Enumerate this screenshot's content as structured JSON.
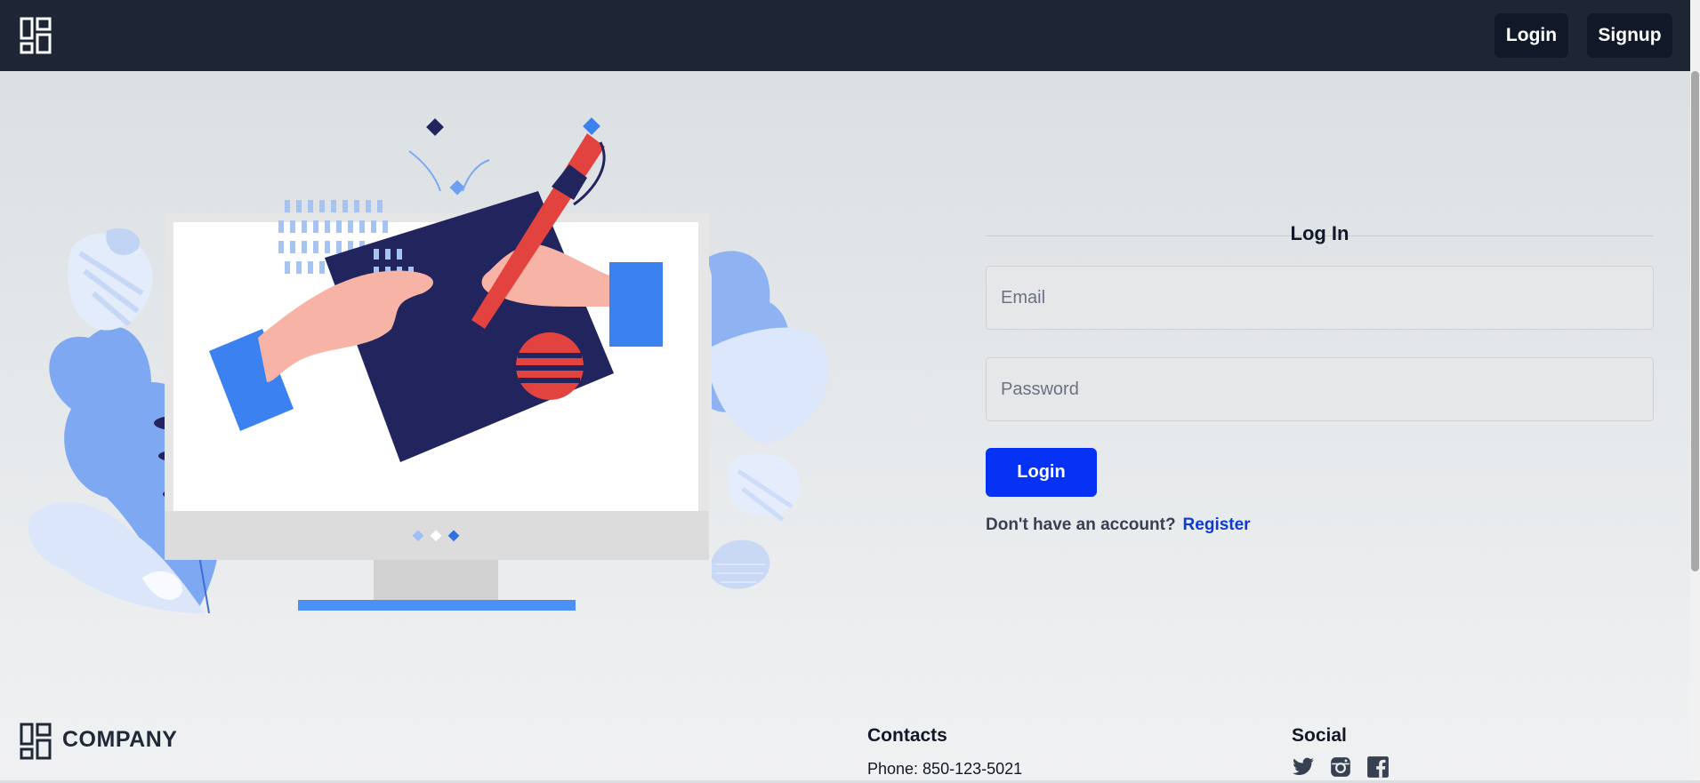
{
  "navbar": {
    "logo_icon": "dashboard-grid-icon",
    "login_label": "Login",
    "signup_label": "Signup",
    "background_color": "#1e2535"
  },
  "illustration": {
    "icon": "hand-drawing-tablet-monitor-illustration"
  },
  "login_form": {
    "title": "Log In",
    "email_placeholder": "Email",
    "password_placeholder": "Password",
    "submit_label": "Login",
    "no_account_text": "Don't have an account?",
    "register_link": "Register",
    "accent_color": "#0532f5"
  },
  "footer": {
    "company": "COMPANY",
    "contacts": {
      "heading": "Contacts",
      "phone": "Phone: 850-123-5021"
    },
    "social": {
      "heading": "Social",
      "icons": [
        "twitter-icon",
        "instagram-icon",
        "facebook-icon"
      ]
    }
  }
}
